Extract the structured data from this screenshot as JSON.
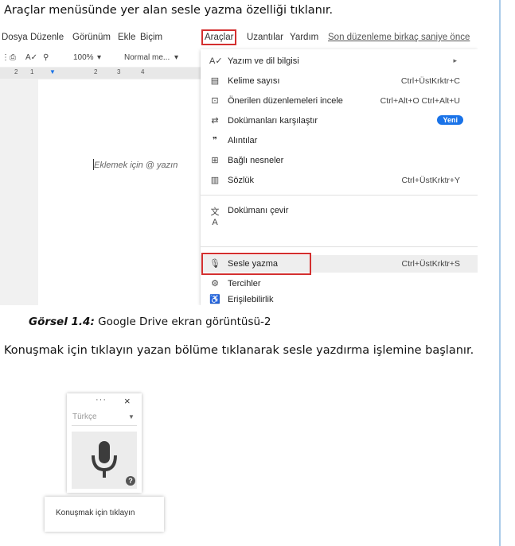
{
  "intro_text": "Araçlar menüsünde yer alan sesle yazma özelliği tıklanır.",
  "menubar": {
    "items": [
      "Dosya",
      "Düzenle",
      "Görünüm",
      "Ekle",
      "Biçim",
      "Araçlar",
      "Uzantılar",
      "Yardım"
    ],
    "last_edit": "Son düzenleme birkaç saniye önce"
  },
  "toolbar": {
    "zoom": "100%",
    "style": "Normal me..."
  },
  "ruler": [
    "2",
    "1",
    "1",
    "2",
    "3",
    "4"
  ],
  "doc": {
    "placeholder": "Eklemek için @ yazın"
  },
  "tools_menu": {
    "items": [
      {
        "icon": "A✓",
        "label": "Yazım ve dil bilgisi",
        "shortcut": ""
      },
      {
        "icon": "▤",
        "label": "Kelime sayısı",
        "shortcut": "Ctrl+ÜstKrktr+C"
      },
      {
        "icon": "⊡",
        "label": "Önerilen düzenlemeleri incele",
        "shortcut": "Ctrl+Alt+O Ctrl+Alt+U"
      },
      {
        "icon": "⇄",
        "label": "Dokümanları karşılaştır",
        "shortcut": ""
      },
      {
        "icon": "❞",
        "label": "Alıntılar",
        "shortcut": ""
      },
      {
        "icon": "⊞",
        "label": "Bağlı nesneler",
        "shortcut": ""
      },
      {
        "icon": "▥",
        "label": "Sözlük",
        "shortcut": "Ctrl+ÜstKrktr+Y"
      },
      {
        "icon": "文A",
        "label": "Dokümanı çevir",
        "shortcut": ""
      },
      {
        "icon": "🎙",
        "label": "Sesle yazma",
        "shortcut": "Ctrl+ÜstKrktr+S"
      },
      {
        "icon": "⚙",
        "label": "Tercihler",
        "shortcut": ""
      },
      {
        "icon": "♿",
        "label": "Erişilebilirlik",
        "shortcut": ""
      }
    ],
    "new_badge": "Yeni",
    "highlight_color": "#d32f2f",
    "badge_color": "#1a73e8"
  },
  "caption": {
    "label": "Görsel 1.4:",
    "text": " Google Drive ekran görüntüsü-2"
  },
  "body_text": "Konuşmak için tıklayın yazan bölüme tıklanarak sesle yazdırma işlemine başlanır.",
  "voice_widget": {
    "dots": "···",
    "close": "×",
    "language": "Türkçe",
    "help": "?",
    "tooltip": "Konuşmak için tıklayın"
  }
}
